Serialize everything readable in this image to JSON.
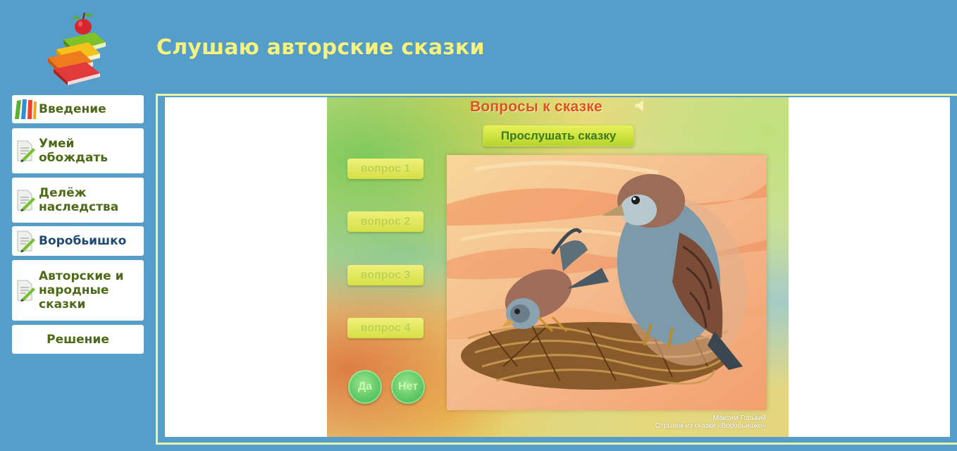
{
  "header": {
    "title": "Слушаю авторские сказки",
    "logo_icon": "books-apple-icon"
  },
  "sidebar": {
    "items": [
      {
        "label": "Введение",
        "icon": "books-icon"
      },
      {
        "label": "Умей обождать",
        "line1": "Умей",
        "line2": "обождать",
        "icon": "document-pencil-icon"
      },
      {
        "label": "Делёж наследства",
        "line1": "Делёж",
        "line2": "наследства",
        "icon": "document-pencil-icon"
      },
      {
        "label": "Воробьишко",
        "icon": "document-pencil-icon",
        "active": true
      },
      {
        "label": "Авторские и народные сказки",
        "line1": "Авторские и",
        "line2": "народные",
        "line3": "сказки",
        "icon": "document-pencil-icon"
      },
      {
        "label": "Решение"
      }
    ]
  },
  "activity": {
    "title": "Вопросы к сказке",
    "speaker_icon": "speaker-icon",
    "listen_button": "Прослушать сказку",
    "questions": [
      "вопрос 1",
      "вопрос 2",
      "вопрос 3",
      "вопрос 4"
    ],
    "yes_button": "Да",
    "no_button": "Нет",
    "caption": {
      "author": "Максим Горький",
      "source": "Отрывок из сказки «Воробьишко»"
    }
  },
  "colors": {
    "background": "#549ec9",
    "title": "#f6f27e",
    "nav_text": "#4d6a18",
    "nav_active_text": "#1f4a72",
    "frame_border": "#edf3a4",
    "activity_title": "#d9541e"
  }
}
